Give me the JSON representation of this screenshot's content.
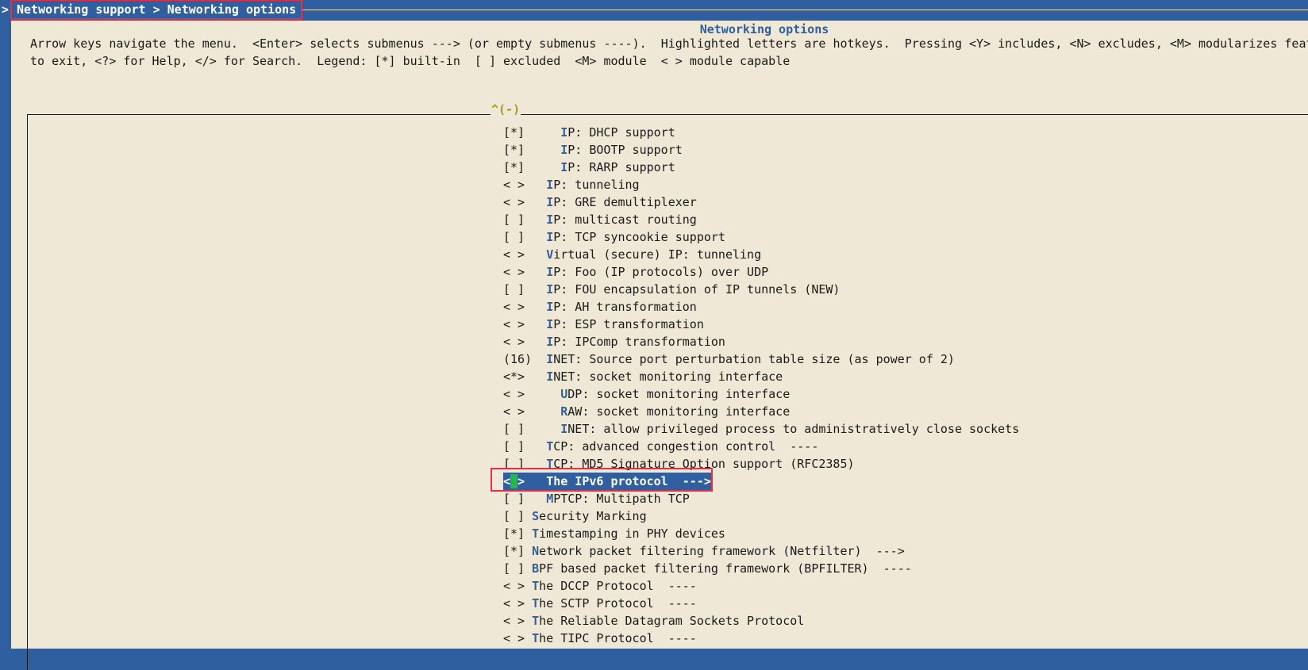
{
  "breadcrumb": "Networking support > Networking options",
  "caret": ">",
  "dialog_title": "Networking options",
  "help_lines": [
    "Arrow keys navigate the menu.  <Enter> selects submenus ---> (or empty submenus ----).  Highlighted letters are hotkeys.  Pressing <Y> includes, <N> excludes, <M> modularizes feat",
    "to exit, <?> for Help, </> for Search.  Legend: [*] built-in  [ ] excluded  <M> module  < > module capable"
  ],
  "scroll_indicator": "^(-)",
  "menu": [
    {
      "state": "[*]",
      "indent": "    ",
      "hotkey": "I",
      "rest": "P: DHCP support"
    },
    {
      "state": "[*]",
      "indent": "    ",
      "hotkey": "I",
      "rest": "P: BOOTP support"
    },
    {
      "state": "[*]",
      "indent": "    ",
      "hotkey": "I",
      "rest": "P: RARP support"
    },
    {
      "state": "< >",
      "indent": "  ",
      "hotkey": "I",
      "rest": "P: tunneling"
    },
    {
      "state": "< >",
      "indent": "  ",
      "hotkey": "I",
      "rest": "P: GRE demultiplexer"
    },
    {
      "state": "[ ]",
      "indent": "  ",
      "hotkey": "I",
      "rest": "P: multicast routing"
    },
    {
      "state": "[ ]",
      "indent": "  ",
      "hotkey": "I",
      "rest": "P: TCP syncookie support"
    },
    {
      "state": "< >",
      "indent": "  ",
      "hotkey": "V",
      "rest": "irtual (secure) IP: tunneling"
    },
    {
      "state": "< >",
      "indent": "  ",
      "hotkey": "I",
      "rest": "P: Foo (IP protocols) over UDP"
    },
    {
      "state": "[ ]",
      "indent": "  ",
      "hotkey": "I",
      "rest": "P: FOU encapsulation of IP tunnels (NEW)"
    },
    {
      "state": "< >",
      "indent": "  ",
      "hotkey": "I",
      "rest": "P: AH transformation"
    },
    {
      "state": "< >",
      "indent": "  ",
      "hotkey": "I",
      "rest": "P: ESP transformation"
    },
    {
      "state": "< >",
      "indent": "  ",
      "hotkey": "I",
      "rest": "P: IPComp transformation"
    },
    {
      "state": "(16)",
      "indent": " ",
      "hotkey": "I",
      "rest": "NET: Source port perturbation table size (as power of 2)"
    },
    {
      "state": "<*>",
      "indent": "  ",
      "hotkey": "I",
      "rest": "NET: socket monitoring interface"
    },
    {
      "state": "< >",
      "indent": "    ",
      "hotkey": "U",
      "rest": "DP: socket monitoring interface"
    },
    {
      "state": "< >",
      "indent": "    ",
      "hotkey": "R",
      "rest": "AW: socket monitoring interface"
    },
    {
      "state": "[ ]",
      "indent": "    ",
      "hotkey": "I",
      "rest": "NET: allow privileged process to administratively close sockets"
    },
    {
      "state": "[ ]",
      "indent": "  ",
      "hotkey": "T",
      "rest": "CP: advanced congestion control  ----"
    },
    {
      "state": "[ ]",
      "indent": "  ",
      "hotkey": "T",
      "rest": "CP: MD5 Signature Option support (RFC2385)"
    },
    {
      "state": "< >",
      "indent": "  ",
      "hotkey": "T",
      "rest": "he IPv6 protocol  --->",
      "selected": true
    },
    {
      "state": "[ ]",
      "indent": "  ",
      "hotkey": "M",
      "rest": "PTCP: Multipath TCP"
    },
    {
      "state": "[ ]",
      "indent": "",
      "hotkey": "S",
      "rest": "ecurity Marking"
    },
    {
      "state": "[*]",
      "indent": "",
      "hotkey": "T",
      "rest": "imestamping in PHY devices"
    },
    {
      "state": "[*]",
      "indent": "",
      "hotkey": "N",
      "rest": "etwork packet filtering framework (Netfilter)  --->"
    },
    {
      "state": "[ ]",
      "indent": "",
      "hotkey": "B",
      "rest": "PF based packet filtering framework (BPFILTER)  ----"
    },
    {
      "state": "< >",
      "indent": "",
      "hotkey": "T",
      "rest": "he DCCP Protocol  ----"
    },
    {
      "state": "< >",
      "indent": "",
      "hotkey": "T",
      "rest": "he SCTP Protocol  ----"
    },
    {
      "state": "< >",
      "indent": "",
      "hotkey": "T",
      "rest": "he Reliable Datagram Sockets Protocol"
    },
    {
      "state": "< >",
      "indent": "",
      "hotkey": "T",
      "rest": "he TIPC Protocol  ----"
    }
  ]
}
